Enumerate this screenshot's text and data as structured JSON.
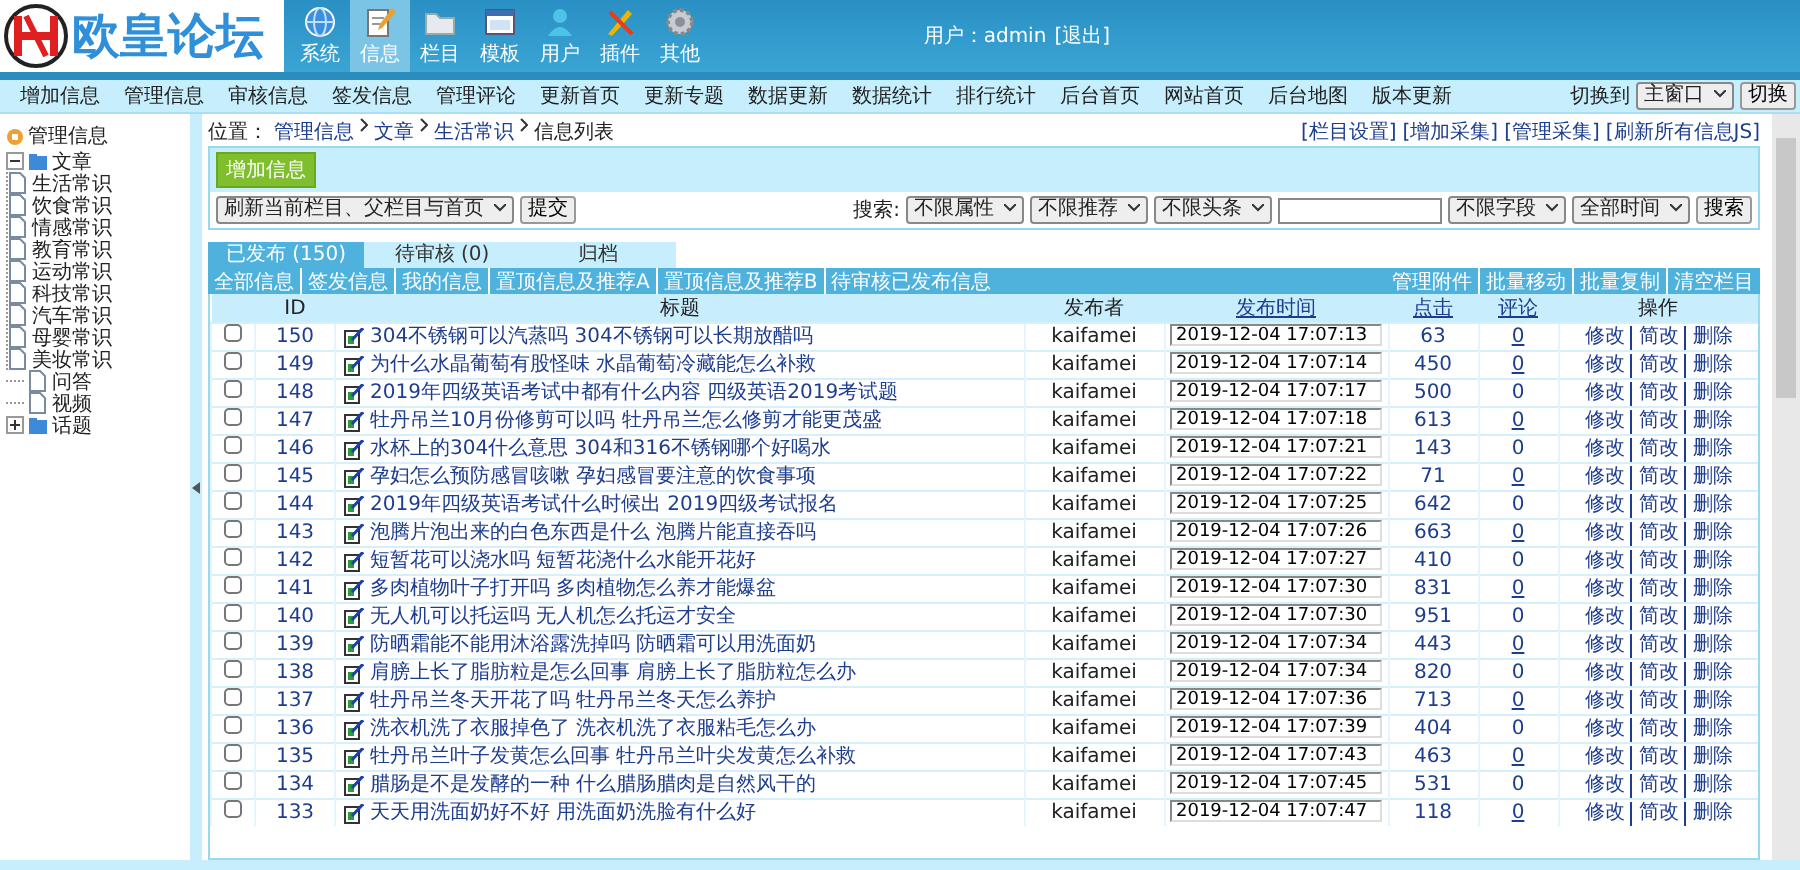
{
  "header": {
    "logo_text": "欧皇论坛",
    "nav": [
      {
        "kind": "globe",
        "label": "系统",
        "selected": false
      },
      {
        "kind": "notepad",
        "label": "信息",
        "selected": true
      },
      {
        "kind": "folder",
        "label": "栏目",
        "selected": false
      },
      {
        "kind": "window",
        "label": "模板",
        "selected": false
      },
      {
        "kind": "user",
        "label": "用户",
        "selected": false
      },
      {
        "kind": "tools",
        "label": "插件",
        "selected": false
      },
      {
        "kind": "gear",
        "label": "其他",
        "selected": false
      }
    ],
    "user_text": "用户：admin",
    "logout": "[退出]"
  },
  "subnav": [
    "增加信息",
    "管理信息",
    "审核信息",
    "签发信息",
    "管理评论",
    "更新首页",
    "更新专题",
    "数据更新",
    "数据统计",
    "排行统计",
    "后台首页",
    "网站首页",
    "后台地图",
    "版本更新"
  ],
  "window_switch": {
    "label": "切换到",
    "value": "主窗口",
    "button": "切换"
  },
  "sidebar": {
    "root": "管理信息",
    "tree": [
      {
        "label": "文章",
        "kind": "folder",
        "expanded": true,
        "children": [
          {
            "label": "生活常识"
          },
          {
            "label": "饮食常识"
          },
          {
            "label": "情感常识"
          },
          {
            "label": "教育常识"
          },
          {
            "label": "运动常识"
          },
          {
            "label": "科技常识"
          },
          {
            "label": "汽车常识"
          },
          {
            "label": "母婴常识"
          },
          {
            "label": "美妆常识"
          }
        ]
      },
      {
        "label": "问答",
        "kind": "page"
      },
      {
        "label": "视频",
        "kind": "page"
      },
      {
        "label": "话题",
        "kind": "folder",
        "expanded": false
      }
    ]
  },
  "breadcrumb": {
    "label": "位置：",
    "items": [
      "管理信息",
      "文章",
      "生活常识"
    ],
    "current": "信息列表"
  },
  "top_links": [
    "[栏目设置]",
    "[增加采集]",
    "[管理采集]",
    "[刷新所有信息JS]"
  ],
  "add_button": "增加信息",
  "refresh": {
    "value": "刷新当前栏目、父栏目与首页",
    "button": "提交"
  },
  "search": {
    "label": "搜索:",
    "filters_before": [
      "不限属性",
      "不限推荐",
      "不限头条"
    ],
    "filters_after": [
      "不限字段",
      "全部时间"
    ],
    "button": "搜索"
  },
  "tabs": [
    {
      "label": "已发布 (150)",
      "selected": true
    },
    {
      "label": "待审核 (0)",
      "selected": false
    },
    {
      "label": "归档",
      "selected": false
    }
  ],
  "actions_left": [
    "全部信息",
    "签发信息",
    "我的信息",
    "置顶信息及推荐A",
    "置顶信息及推荐B",
    "待审核已发布信息"
  ],
  "actions_right": [
    "管理附件",
    "批量移动",
    "批量复制",
    "清空栏目"
  ],
  "table": {
    "columns": [
      "ID",
      "标题",
      "发布者",
      "发布时间",
      "点击",
      "评论",
      "操作"
    ],
    "rows": [
      {
        "checked": false,
        "id": "150",
        "title": "304不锈钢可以汽蒸吗 304不锈钢可以长期放醋吗",
        "author": "kaifamei",
        "time": "2019-12-04 17:07:13",
        "clicks": "63",
        "comments": "0",
        "underlined": true,
        "operations": [
          "修改",
          "简改",
          "删除"
        ]
      },
      {
        "checked": false,
        "id": "149",
        "title": "为什么水晶葡萄有股怪味 水晶葡萄冷藏能怎么补救",
        "author": "kaifamei",
        "time": "2019-12-04 17:07:14",
        "clicks": "450",
        "comments": "0",
        "underlined": true,
        "operations": [
          "修改",
          "简改",
          "删除"
        ]
      },
      {
        "checked": false,
        "id": "148",
        "title": "2019年四级英语考试中都有什么内容 四级英语2019考试题",
        "author": "kaifamei",
        "time": "2019-12-04 17:07:17",
        "clicks": "500",
        "comments": "0",
        "underlined": false,
        "operations": [
          "修改",
          "简改",
          "删除"
        ]
      },
      {
        "checked": false,
        "id": "147",
        "title": "牡丹吊兰10月份修剪可以吗 牡丹吊兰怎么修剪才能更茂盛",
        "author": "kaifamei",
        "time": "2019-12-04 17:07:18",
        "clicks": "613",
        "comments": "0",
        "underlined": true,
        "operations": [
          "修改",
          "简改",
          "删除"
        ]
      },
      {
        "checked": false,
        "id": "146",
        "title": "水杯上的304什么意思 304和316不锈钢哪个好喝水",
        "author": "kaifamei",
        "time": "2019-12-04 17:07:21",
        "clicks": "143",
        "comments": "0",
        "underlined": false,
        "operations": [
          "修改",
          "简改",
          "删除"
        ]
      },
      {
        "checked": false,
        "id": "145",
        "title": "孕妇怎么预防感冒咳嗽 孕妇感冒要注意的饮食事项",
        "author": "kaifamei",
        "time": "2019-12-04 17:07:22",
        "clicks": "71",
        "comments": "0",
        "underlined": true,
        "operations": [
          "修改",
          "简改",
          "删除"
        ]
      },
      {
        "checked": false,
        "id": "144",
        "title": "2019年四级英语考试什么时候出 2019四级考试报名",
        "author": "kaifamei",
        "time": "2019-12-04 17:07:25",
        "clicks": "642",
        "comments": "0",
        "underlined": false,
        "operations": [
          "修改",
          "简改",
          "删除"
        ]
      },
      {
        "checked": false,
        "id": "143",
        "title": "泡腾片泡出来的白色东西是什么 泡腾片能直接吞吗",
        "author": "kaifamei",
        "time": "2019-12-04 17:07:26",
        "clicks": "663",
        "comments": "0",
        "underlined": true,
        "operations": [
          "修改",
          "简改",
          "删除"
        ]
      },
      {
        "checked": false,
        "id": "142",
        "title": "短暂花可以浇水吗 短暂花浇什么水能开花好",
        "author": "kaifamei",
        "time": "2019-12-04 17:07:27",
        "clicks": "410",
        "comments": "0",
        "underlined": false,
        "operations": [
          "修改",
          "简改",
          "删除"
        ]
      },
      {
        "checked": false,
        "id": "141",
        "title": "多肉植物叶子打开吗 多肉植物怎么养才能爆盆",
        "author": "kaifamei",
        "time": "2019-12-04 17:07:30",
        "clicks": "831",
        "comments": "0",
        "underlined": true,
        "operations": [
          "修改",
          "简改",
          "删除"
        ]
      },
      {
        "checked": false,
        "id": "140",
        "title": "无人机可以托运吗 无人机怎么托运才安全",
        "author": "kaifamei",
        "time": "2019-12-04 17:07:30",
        "clicks": "951",
        "comments": "0",
        "underlined": false,
        "operations": [
          "修改",
          "简改",
          "删除"
        ]
      },
      {
        "checked": false,
        "id": "139",
        "title": "防晒霜能不能用沐浴露洗掉吗 防晒霜可以用洗面奶",
        "author": "kaifamei",
        "time": "2019-12-04 17:07:34",
        "clicks": "443",
        "comments": "0",
        "underlined": true,
        "operations": [
          "修改",
          "简改",
          "删除"
        ]
      },
      {
        "checked": false,
        "id": "138",
        "title": "肩膀上长了脂肪粒是怎么回事 肩膀上长了脂肪粒怎么办",
        "author": "kaifamei",
        "time": "2019-12-04 17:07:34",
        "clicks": "820",
        "comments": "0",
        "underlined": false,
        "operations": [
          "修改",
          "简改",
          "删除"
        ]
      },
      {
        "checked": false,
        "id": "137",
        "title": "牡丹吊兰冬天开花了吗 牡丹吊兰冬天怎么养护",
        "author": "kaifamei",
        "time": "2019-12-04 17:07:36",
        "clicks": "713",
        "comments": "0",
        "underlined": true,
        "operations": [
          "修改",
          "简改",
          "删除"
        ]
      },
      {
        "checked": false,
        "id": "136",
        "title": "洗衣机洗了衣服掉色了 洗衣机洗了衣服粘毛怎么办",
        "author": "kaifamei",
        "time": "2019-12-04 17:07:39",
        "clicks": "404",
        "comments": "0",
        "underlined": false,
        "operations": [
          "修改",
          "简改",
          "删除"
        ]
      },
      {
        "checked": false,
        "id": "135",
        "title": "牡丹吊兰叶子发黄怎么回事 牡丹吊兰叶尖发黄怎么补救",
        "author": "kaifamei",
        "time": "2019-12-04 17:07:43",
        "clicks": "463",
        "comments": "0",
        "underlined": true,
        "operations": [
          "修改",
          "简改",
          "删除"
        ]
      },
      {
        "checked": false,
        "id": "134",
        "title": "腊肠是不是发酵的一种 什么腊肠腊肉是自然风干的",
        "author": "kaifamei",
        "time": "2019-12-04 17:07:45",
        "clicks": "531",
        "comments": "0",
        "underlined": false,
        "operations": [
          "修改",
          "简改",
          "删除"
        ]
      },
      {
        "checked": false,
        "id": "133",
        "title": "天天用洗面奶好不好 用洗面奶洗脸有什么好",
        "author": "kaifamei",
        "time": "2019-12-04 17:07:47",
        "clicks": "118",
        "comments": "0",
        "underlined": true,
        "operations": [
          "修改",
          "简改",
          "删除"
        ]
      }
    ]
  }
}
